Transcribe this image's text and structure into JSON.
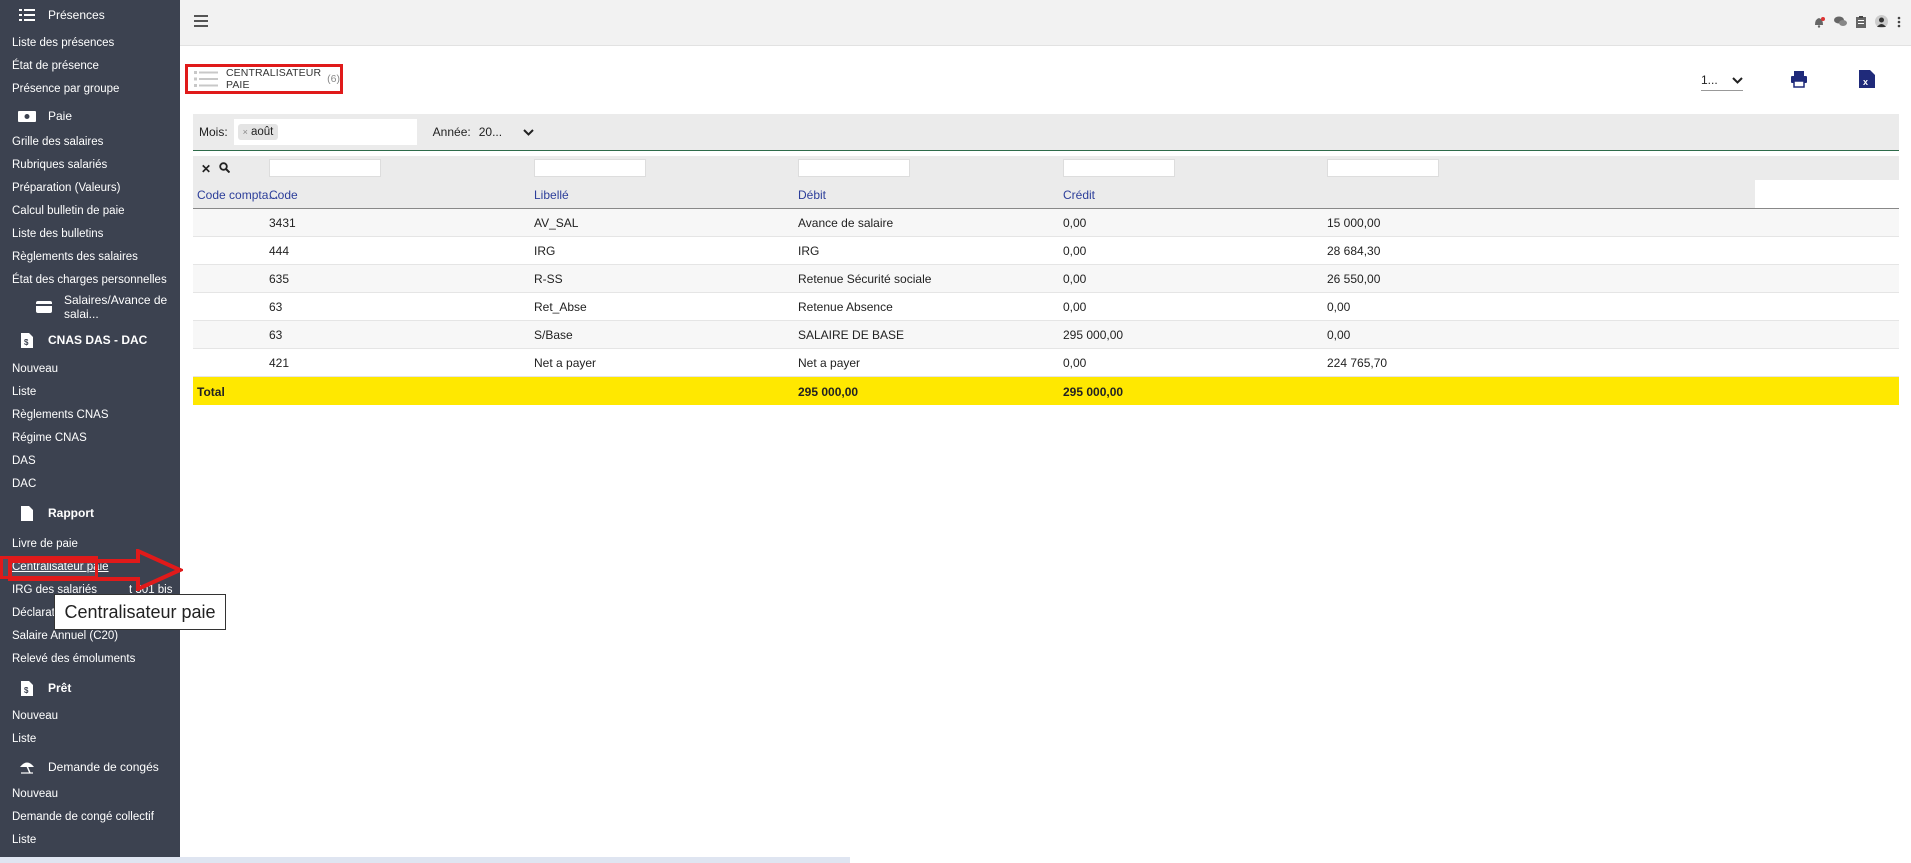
{
  "sidebar": {
    "sections": [
      {
        "title": "Présences",
        "icon": "list-icon",
        "items": [
          "Liste des présences",
          "État de présence",
          "Présence par groupe"
        ]
      },
      {
        "title": "Paie",
        "icon": "money-icon",
        "items": [
          "Grille des salaires",
          "Rubriques salariés",
          "Préparation (Valeurs)",
          "Calcul bulletin de paie",
          "Liste des bulletins",
          "Règlements des salaires",
          "État des charges personnelles"
        ]
      },
      {
        "title": "Salaires/Avance de salai...",
        "icon": "wallet-icon",
        "items": []
      },
      {
        "title": "CNAS DAS - DAC",
        "icon": "document-dollar-icon",
        "items": [
          "Nouveau",
          "Liste",
          "Règlements CNAS",
          "Régime CNAS",
          "DAS",
          "DAC"
        ]
      },
      {
        "title": "Rapport",
        "icon": "file-icon",
        "items": [
          "Livre de paie",
          "Centralisateur paie",
          "IRG des salariés et 301 bis",
          "Déclaration",
          "Salaire Annuel (C20)",
          "Relevé des émoluments"
        ]
      },
      {
        "title": "Prêt",
        "icon": "document-dollar-icon",
        "items": [
          "Nouveau",
          "Liste"
        ]
      },
      {
        "title": "Demande de congés",
        "icon": "umbrella-icon",
        "items": [
          "Nouveau",
          "Demande de congé collectif",
          "Liste"
        ]
      }
    ],
    "irg_visible_start": "IRG des salariés",
    "irg_visible_end": "t 301 bis",
    "declaration_visible": "Déclarati"
  },
  "tooltip": "Centralisateur paie",
  "page": {
    "title": "CENTRALISATEUR PAIE",
    "count": "(6)",
    "pager_value": "1...",
    "filters": {
      "mois_label": "Mois:",
      "mois_chip": "août",
      "annee_label": "Année:",
      "annee_value": "20..."
    }
  },
  "table": {
    "columns": [
      "Code compta...",
      "Code",
      "Libellé",
      "Débit",
      "Crédit"
    ],
    "rows": [
      [
        "",
        "3431",
        "AV_SAL",
        "Avance de salaire",
        "0,00",
        "15 000,00"
      ],
      [
        "",
        "444",
        "IRG",
        "IRG",
        "0,00",
        "28 684,30"
      ],
      [
        "",
        "635",
        "R-SS",
        "Retenue Sécurité sociale",
        "0,00",
        "26 550,00"
      ],
      [
        "",
        "63",
        "Ret_Abse",
        "Retenue Absence",
        "0,00",
        "0,00"
      ],
      [
        "",
        "63",
        "S/Base",
        "SALAIRE DE BASE",
        "295 000,00",
        "0,00"
      ],
      [
        "",
        "421",
        "Net a payer",
        "Net a payer",
        "0,00",
        "224 765,70"
      ]
    ],
    "total": {
      "label": "Total",
      "debit": "295 000,00",
      "credit": "295 000,00"
    }
  },
  "colors": {
    "sidebar_bg": "#3c4250",
    "highlight_red": "#e01a1a",
    "total_yellow": "#ffe800",
    "header_blue": "#2c3e9a",
    "icon_navy": "#1f2a7a"
  }
}
